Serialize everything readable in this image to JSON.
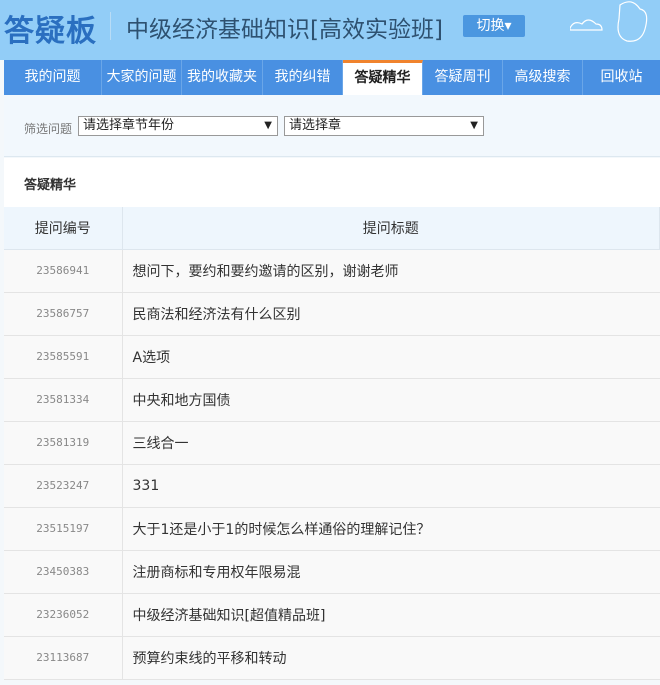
{
  "header": {
    "logo": "答疑板",
    "course": "中级经济基础知识[高效实验班]",
    "switch_label": "切换▾"
  },
  "nav": {
    "tabs": [
      {
        "label": "我的问题",
        "active": false
      },
      {
        "label": "大家的问题",
        "active": false
      },
      {
        "label": "我的收藏夹",
        "active": false
      },
      {
        "label": "我的纠错",
        "active": false
      },
      {
        "label": "答疑精华",
        "active": true
      },
      {
        "label": "答疑周刊",
        "active": false
      },
      {
        "label": "高级搜索",
        "active": false
      },
      {
        "label": "回收站",
        "active": false
      }
    ]
  },
  "filter": {
    "label": "筛选问题",
    "year_select": "请选择章节年份",
    "chapter_select": "请选择章",
    "arrow": "▼"
  },
  "section": {
    "title": "答疑精华"
  },
  "table": {
    "headers": [
      "提问编号",
      "提问标题"
    ],
    "rows": [
      {
        "id": "23586941",
        "title": "想问下，要约和要约邀请的区别，谢谢老师"
      },
      {
        "id": "23586757",
        "title": "民商法和经济法有什么区别"
      },
      {
        "id": "23585591",
        "title": "A选项"
      },
      {
        "id": "23581334",
        "title": "中央和地方国债"
      },
      {
        "id": "23581319",
        "title": "三线合一"
      },
      {
        "id": "23523247",
        "title": "331"
      },
      {
        "id": "23515197",
        "title": "大于1还是小于1的时候怎么样通俗的理解记住？"
      },
      {
        "id": "23450383",
        "title": "注册商标和专用权年限易混"
      },
      {
        "id": "23236052",
        "title": "中级经济基础知识[超值精品班]"
      },
      {
        "id": "23113687",
        "title": "预算约束线的平移和转动"
      }
    ]
  }
}
